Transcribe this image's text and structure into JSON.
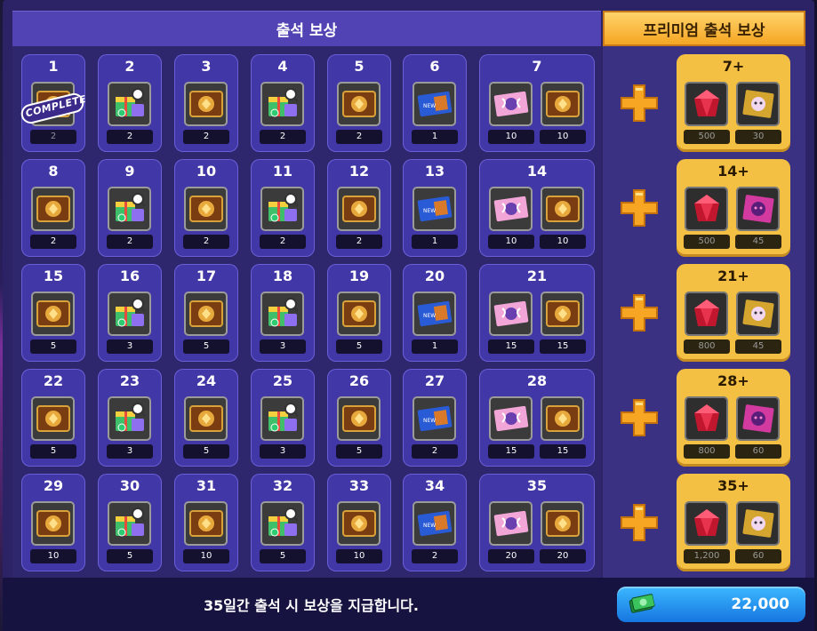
{
  "header": {
    "left_title": "출석 보상",
    "right_title": "프리미엄 출석 보상"
  },
  "footer": {
    "text": "35일간 출석 시 보상을 지급합니다.",
    "currency_value": "22,000",
    "currency_icon": "cash-bills-icon"
  },
  "complete_stamp": "COMPLETE",
  "rows": [
    {
      "cells": [
        {
          "day": "1",
          "items": [
            {
              "icon": "gold-ticket-icon",
              "qty": "2"
            }
          ],
          "complete": true
        },
        {
          "day": "2",
          "items": [
            {
              "icon": "gift-box-icon",
              "qty": "2"
            }
          ]
        },
        {
          "day": "3",
          "items": [
            {
              "icon": "gold-ticket-icon",
              "qty": "2"
            }
          ]
        },
        {
          "day": "4",
          "items": [
            {
              "icon": "gift-box-icon",
              "qty": "2"
            }
          ]
        },
        {
          "day": "5",
          "items": [
            {
              "icon": "gold-ticket-icon",
              "qty": "2"
            }
          ]
        },
        {
          "day": "6",
          "items": [
            {
              "icon": "blue-ticket-icon",
              "qty": "1"
            }
          ]
        },
        {
          "day": "7",
          "items": [
            {
              "icon": "pink-ticket-icon",
              "qty": "10"
            },
            {
              "icon": "gold-ticket-icon",
              "qty": "10"
            }
          ]
        }
      ],
      "premium": {
        "day": "7+",
        "items": [
          {
            "icon": "ruby-icon",
            "qty": "500"
          },
          {
            "icon": "gold-costume-ticket-icon",
            "qty": "30"
          }
        ]
      }
    },
    {
      "cells": [
        {
          "day": "8",
          "items": [
            {
              "icon": "gold-ticket-icon",
              "qty": "2"
            }
          ]
        },
        {
          "day": "9",
          "items": [
            {
              "icon": "gift-box-icon",
              "qty": "2"
            }
          ]
        },
        {
          "day": "10",
          "items": [
            {
              "icon": "gold-ticket-icon",
              "qty": "2"
            }
          ]
        },
        {
          "day": "11",
          "items": [
            {
              "icon": "gift-box-icon",
              "qty": "2"
            }
          ]
        },
        {
          "day": "12",
          "items": [
            {
              "icon": "gold-ticket-icon",
              "qty": "2"
            }
          ]
        },
        {
          "day": "13",
          "items": [
            {
              "icon": "blue-ticket-icon",
              "qty": "1"
            }
          ]
        },
        {
          "day": "14",
          "items": [
            {
              "icon": "pink-ticket-icon",
              "qty": "10"
            },
            {
              "icon": "gold-ticket-icon",
              "qty": "10"
            }
          ]
        }
      ],
      "premium": {
        "day": "14+",
        "items": [
          {
            "icon": "ruby-icon",
            "qty": "500"
          },
          {
            "icon": "pink-costume-ticket-icon",
            "qty": "45"
          }
        ]
      }
    },
    {
      "cells": [
        {
          "day": "15",
          "items": [
            {
              "icon": "gold-ticket-icon",
              "qty": "5"
            }
          ]
        },
        {
          "day": "16",
          "items": [
            {
              "icon": "gift-box-icon",
              "qty": "3"
            }
          ]
        },
        {
          "day": "17",
          "items": [
            {
              "icon": "gold-ticket-icon",
              "qty": "5"
            }
          ]
        },
        {
          "day": "18",
          "items": [
            {
              "icon": "gift-box-icon",
              "qty": "3"
            }
          ]
        },
        {
          "day": "19",
          "items": [
            {
              "icon": "gold-ticket-icon",
              "qty": "5"
            }
          ]
        },
        {
          "day": "20",
          "items": [
            {
              "icon": "blue-ticket-icon",
              "qty": "1"
            }
          ]
        },
        {
          "day": "21",
          "items": [
            {
              "icon": "pink-ticket-icon",
              "qty": "15"
            },
            {
              "icon": "gold-ticket-icon",
              "qty": "15"
            }
          ]
        }
      ],
      "premium": {
        "day": "21+",
        "items": [
          {
            "icon": "ruby-icon",
            "qty": "800"
          },
          {
            "icon": "gold-costume-ticket-icon",
            "qty": "45"
          }
        ]
      }
    },
    {
      "cells": [
        {
          "day": "22",
          "items": [
            {
              "icon": "gold-ticket-icon",
              "qty": "5"
            }
          ]
        },
        {
          "day": "23",
          "items": [
            {
              "icon": "gift-box-icon",
              "qty": "3"
            }
          ]
        },
        {
          "day": "24",
          "items": [
            {
              "icon": "gold-ticket-icon",
              "qty": "5"
            }
          ]
        },
        {
          "day": "25",
          "items": [
            {
              "icon": "gift-box-icon",
              "qty": "3"
            }
          ]
        },
        {
          "day": "26",
          "items": [
            {
              "icon": "gold-ticket-icon",
              "qty": "5"
            }
          ]
        },
        {
          "day": "27",
          "items": [
            {
              "icon": "blue-ticket-icon",
              "qty": "2"
            }
          ]
        },
        {
          "day": "28",
          "items": [
            {
              "icon": "pink-ticket-icon",
              "qty": "15"
            },
            {
              "icon": "gold-ticket-icon",
              "qty": "15"
            }
          ]
        }
      ],
      "premium": {
        "day": "28+",
        "items": [
          {
            "icon": "ruby-icon",
            "qty": "800"
          },
          {
            "icon": "pink-costume-ticket-icon",
            "qty": "60"
          }
        ]
      }
    },
    {
      "cells": [
        {
          "day": "29",
          "items": [
            {
              "icon": "gold-ticket-icon",
              "qty": "10"
            }
          ]
        },
        {
          "day": "30",
          "items": [
            {
              "icon": "gift-box-icon",
              "qty": "5"
            }
          ]
        },
        {
          "day": "31",
          "items": [
            {
              "icon": "gold-ticket-icon",
              "qty": "10"
            }
          ]
        },
        {
          "day": "32",
          "items": [
            {
              "icon": "gift-box-icon",
              "qty": "5"
            }
          ]
        },
        {
          "day": "33",
          "items": [
            {
              "icon": "gold-ticket-icon",
              "qty": "10"
            }
          ]
        },
        {
          "day": "34",
          "items": [
            {
              "icon": "blue-ticket-icon",
              "qty": "2"
            }
          ]
        },
        {
          "day": "35",
          "items": [
            {
              "icon": "pink-ticket-icon",
              "qty": "20"
            },
            {
              "icon": "gold-ticket-icon",
              "qty": "20"
            }
          ]
        }
      ],
      "premium": {
        "day": "35+",
        "items": [
          {
            "icon": "ruby-icon",
            "qty": "1,200"
          },
          {
            "icon": "gold-costume-ticket-icon",
            "qty": "60"
          }
        ]
      }
    }
  ],
  "colors": {
    "panel": "#2b2366",
    "cell": "#4237a6",
    "premium_gold": "#f3c043",
    "header_blue": "#5143b4",
    "plus_orange": "#f6a623"
  }
}
